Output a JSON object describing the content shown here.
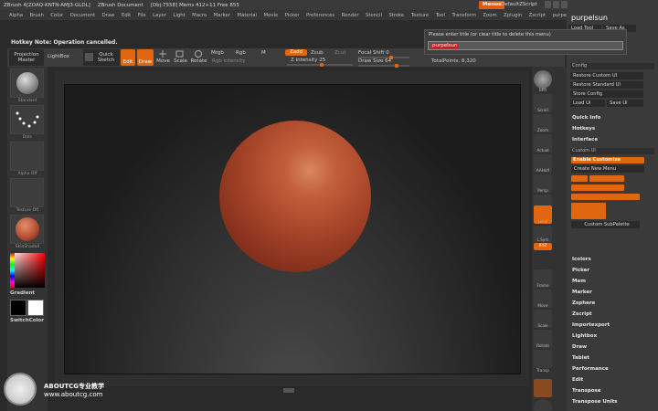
{
  "app": {
    "title_items": [
      "ZBrush 4[ZOAQ-KNTN-AMJ3-GLDL]",
      "ZBrush Document",
      "[Obj:7558] Mems 412+11 Free 855"
    ],
    "menus_button": "Menus",
    "default_zscript": "DefaultZScript"
  },
  "menubar": [
    "Alpha",
    "Brush",
    "Color",
    "Document",
    "Draw",
    "Edit",
    "File",
    "Layer",
    "Light",
    "Macro",
    "Marker",
    "Material",
    "Movie",
    "Picker",
    "Preferences",
    "Render",
    "Stencil",
    "Stroke",
    "Texture",
    "Tool",
    "Transform",
    "Zoom",
    "Zplugin",
    "Zscript",
    "purpelsun"
  ],
  "hotkey_note": "Hotkey Note: Operation cancelled.",
  "toolbar": {
    "projection_master": "Projection Master",
    "lightbox": "LightBox",
    "quick_sketch": "Quick Sketch",
    "edit": "Edit",
    "draw": "Draw",
    "move": "Move",
    "scale": "Scale",
    "rotate": "Rotate",
    "mrgb": "Mrgb",
    "rgb": "Rgb",
    "m": "M",
    "rgb_intensity": "Rgb Intensity",
    "zadd": "Zadd",
    "zsub": "Zsub",
    "zcut": "Zcut",
    "z_intensity_label": "Z Intensity",
    "z_intensity_value": "25",
    "focal_shift_label": "Focal Shift",
    "focal_shift_value": "0",
    "draw_size_label": "Draw Size",
    "draw_size_value": "64",
    "total_points_label": "TotalPoints:",
    "total_points_value": "8,320"
  },
  "left_panel": {
    "thumbs": [
      "Standard",
      "Dots",
      "Alpha Off",
      "Texture Off",
      "SkinShade4"
    ],
    "gradient": "Gradient",
    "switch_color": "SwitchColor"
  },
  "dialog": {
    "prompt": "Please enter title (or clear title to delete this menu)",
    "value": "purpelsun"
  },
  "right_toolbar": [
    "BPR",
    "Scroll",
    "Zoom",
    "Actual",
    "AAHalf",
    "Persp",
    "Floor",
    "Local",
    "L.Sym",
    "Frame",
    "Move",
    "Scale",
    "Rotate",
    "Transp"
  ],
  "right_toolbar_badge": "XYZ",
  "right_panel": {
    "title": "purpelsun",
    "load_tool": "Load Tool",
    "save_as": "Save As",
    "config": "Config",
    "restore_custom_ui": "Restore Custom UI",
    "restore_standard_ui": "Restore Standard UI",
    "store_config": "Store Config",
    "load_ui": "Load Ui",
    "save_ui": "Save Ui",
    "quick_info": "Quick Info",
    "hotkeys": "Hotkeys",
    "interface": "Interface",
    "custom_ui": "Custom UI",
    "enable_customize": "Enable Customize",
    "create_new_menu": "Create New Menu",
    "custom_subpalette": "Custom SubPalette",
    "menu_list": [
      "Icolors",
      "Picker",
      "Mem",
      "Marker",
      "Zsphere",
      "Zscript",
      "Importexport",
      "Lightbox",
      "Draw",
      "Tablet",
      "Performance",
      "Edit",
      "Transpose",
      "Transpose Units"
    ]
  },
  "watermark": {
    "line1": "ABOUTCG专业教学",
    "line2": "www.aboutcg.com"
  },
  "colors": {
    "accent": "#e0670f",
    "panel": "#3a3a3a",
    "sphere": "#a8462a"
  }
}
